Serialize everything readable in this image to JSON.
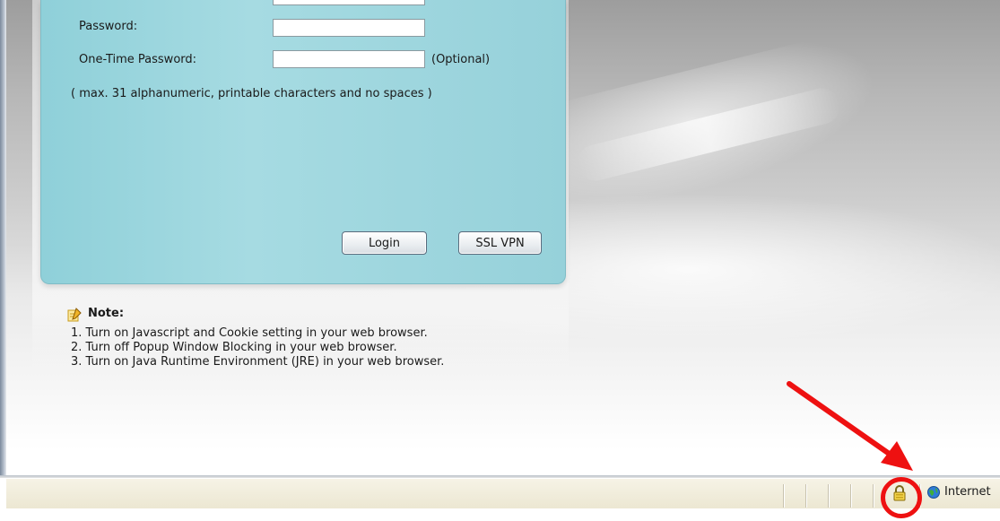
{
  "login": {
    "password_label": "Password:",
    "otp_label": "One-Time Password:",
    "optional_text": "(Optional)",
    "hint": "( max. 31 alphanumeric, printable characters and no spaces )",
    "login_button": "Login",
    "ssl_vpn_button": "SSL VPN"
  },
  "note": {
    "title": "Note:",
    "items": [
      "1. Turn on Javascript and Cookie setting in your web browser.",
      "2. Turn off Popup Window Blocking in your web browser.",
      "3. Turn on Java Runtime Environment (JRE) in your web browser."
    ]
  },
  "statusbar": {
    "zone": "Internet",
    "lock_icon": "padlock-icon",
    "zone_icon": "internet-globe-icon"
  },
  "annotation": {
    "color": "#ee1111"
  },
  "colors": {
    "panel": "#9fd7df",
    "statusbar": "#ece9d8"
  }
}
